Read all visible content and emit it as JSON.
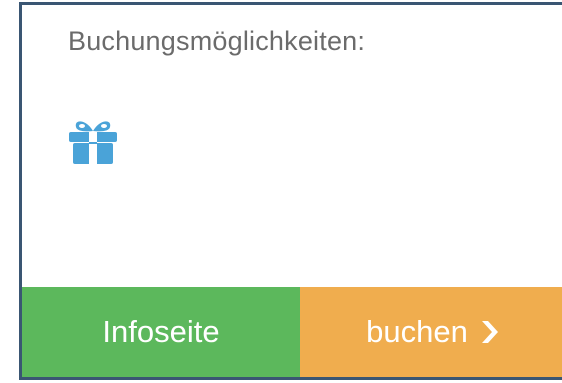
{
  "booking_panel": {
    "heading": "Buchungsmöglichkeiten:",
    "gift_icon": "gift-icon",
    "colors": {
      "border": "#3a5673",
      "heading_text": "#6b6b6b",
      "gift_icon": "#4aa3d8",
      "info_button": "#5cb85c",
      "book_button": "#f0ad4e",
      "button_text": "#ffffff"
    }
  },
  "buttons": {
    "info_label": "Infoseite",
    "book_label": "buchen",
    "book_icon": "chevron-right-icon"
  }
}
